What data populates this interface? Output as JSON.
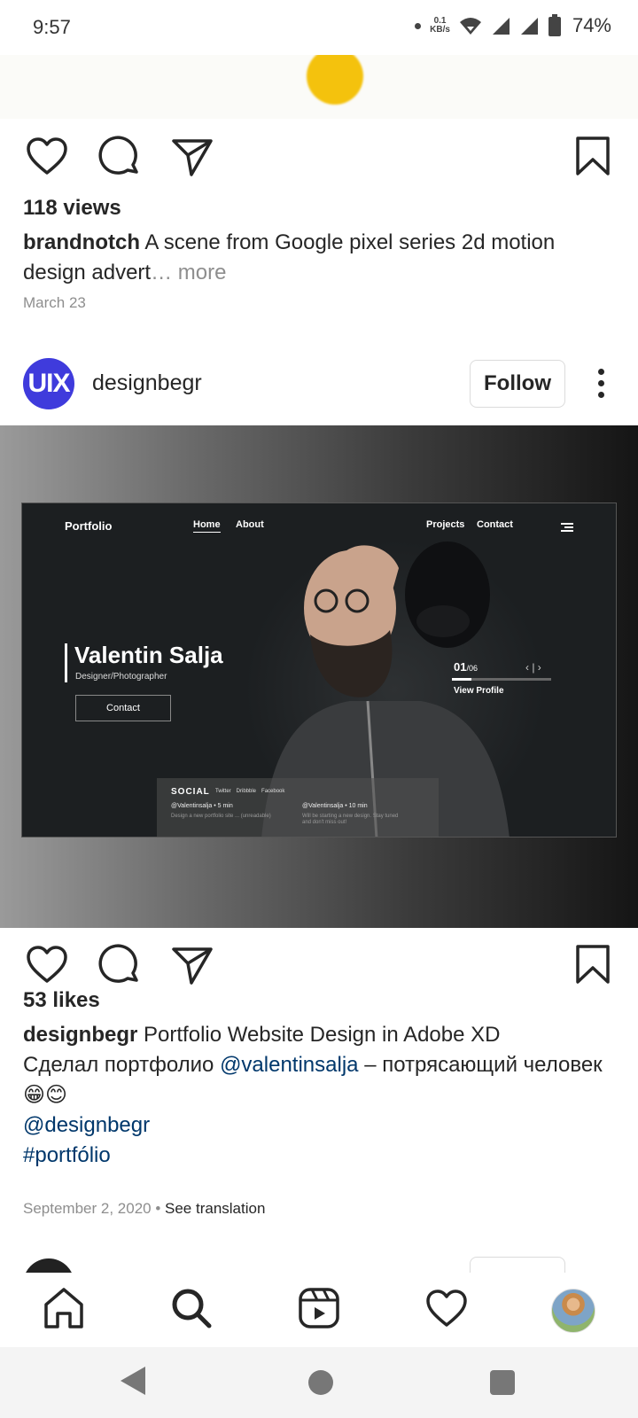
{
  "status_bar": {
    "time": "9:57",
    "net_speed_value": "0.1",
    "net_speed_unit": "KB/s",
    "battery": "74%"
  },
  "previous_post": {
    "views": "118 views",
    "username": "brandnotch",
    "caption": "A scene from Google pixel series 2d motion design advert",
    "more": "… more",
    "date": "March 23"
  },
  "post": {
    "username": "designbegr",
    "avatar_text": "UIX",
    "follow_label": "Follow",
    "likes": "53 likes",
    "caption_line1": "Portfolio Website Design in Adobe XD",
    "caption_line2_pre": "Сделал портфолио",
    "caption_mention1": "@valentinsalja",
    "caption_line2_post": "– потрясающий человек😁😊",
    "caption_mention2": "@designbegr",
    "caption_hashtag": "#portfólio",
    "date": "September 2, 2020",
    "see_translation": "See translation",
    "image": {
      "brand": "Portfolio",
      "nav_home": "Home",
      "nav_about": "About",
      "nav_projects": "Projects",
      "nav_contact": "Contact",
      "name": "Valentin Salja",
      "role": "Designer/Photographer",
      "contact_button": "Contact",
      "counter_current": "01",
      "counter_total": "/06",
      "arrows": "‹ | ›",
      "view_profile": "View Profile",
      "social_title": "SOCIAL",
      "social_links": [
        "Twitter",
        "Dribbble",
        "Facebook"
      ],
      "tweet1_handle": "@Valentinsalja • 5 min",
      "tweet1_text": "Design a new portfolio site ... (unreadable)",
      "tweet2_handle": "@Valentinsalja • 10 min",
      "tweet2_text": "Will be starting a new design. Stay tuned and don't miss out!",
      "progress": 0.2
    }
  },
  "tab_bar": {
    "items": [
      "home-icon",
      "search-icon",
      "reels-icon",
      "activity-heart-icon",
      "profile-avatar"
    ]
  },
  "colors": {
    "text": "#262626",
    "secondary": "#8e8e8e",
    "link": "#00376b",
    "avatar_bg": "#3f3bdc"
  }
}
